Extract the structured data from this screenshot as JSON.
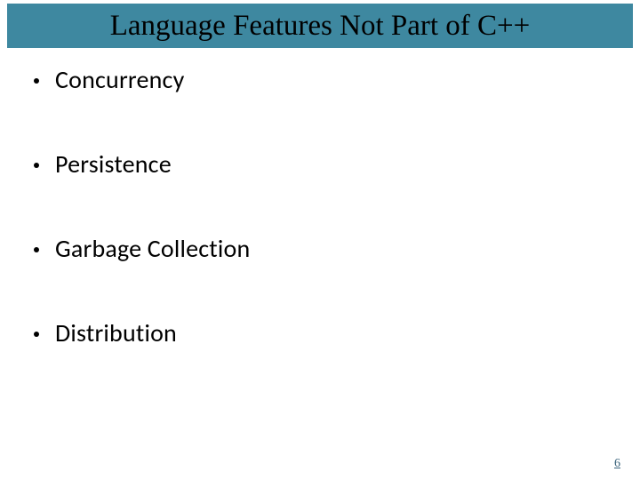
{
  "title": "Language Features Not Part of C++",
  "bullets": [
    "Concurrency",
    "Persistence",
    "Garbage Collection",
    "Distribution"
  ],
  "page_number": "6"
}
